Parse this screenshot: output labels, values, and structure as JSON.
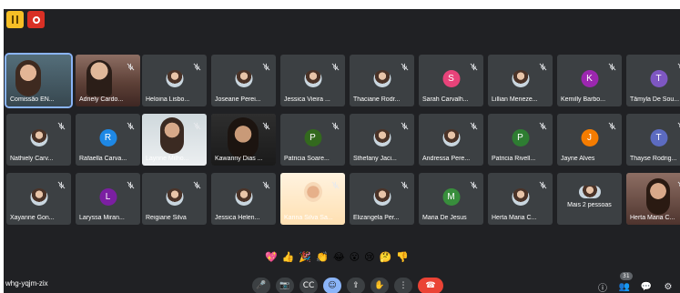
{
  "meeting_code": "whg-yqjm-zix",
  "participant_count": "31",
  "participants": [
    {
      "name": "Comissão EN...",
      "kind": "video",
      "video": "v7",
      "active": true
    },
    {
      "name": "Adriely Cardo...",
      "kind": "video",
      "video": "v1"
    },
    {
      "name": "Heloina Lisbo...",
      "kind": "photo"
    },
    {
      "name": "Joseane Perei...",
      "kind": "photo"
    },
    {
      "name": "Jessica Vieira ...",
      "kind": "photo"
    },
    {
      "name": "Thaciane Rodr...",
      "kind": "photo"
    },
    {
      "name": "Sarah Carvalh...",
      "kind": "letter",
      "letter": "S",
      "color": "#e8437a"
    },
    {
      "name": "Lillian Meneze...",
      "kind": "photo"
    },
    {
      "name": "Kemilly Barbo...",
      "kind": "letter",
      "letter": "K",
      "color": "#9c27b0"
    },
    {
      "name": "Tâmyla De Sou...",
      "kind": "letter",
      "letter": "T",
      "color": "#7e57c2"
    },
    {
      "name": "Nathiely Carv...",
      "kind": "photo"
    },
    {
      "name": "Rafaella Carva...",
      "kind": "letter",
      "letter": "R",
      "color": "#1e88e5"
    },
    {
      "name": "Laynne Milho...",
      "kind": "video",
      "video": "v2"
    },
    {
      "name": "Kawanny Dias ...",
      "kind": "video",
      "video": "v4"
    },
    {
      "name": "Patricia Soare...",
      "kind": "letter",
      "letter": "P",
      "color": "#33691e"
    },
    {
      "name": "Sthefany Jaci...",
      "kind": "photo"
    },
    {
      "name": "Andressa Pere...",
      "kind": "photo"
    },
    {
      "name": "Patricia Rivell...",
      "kind": "letter",
      "letter": "P",
      "color": "#2e7d32"
    },
    {
      "name": "Jayne Alves",
      "kind": "letter",
      "letter": "J",
      "color": "#f57c00"
    },
    {
      "name": "Thayse Rodrig...",
      "kind": "letter",
      "letter": "T",
      "color": "#5c6bc0"
    },
    {
      "name": "Xayanne Gon...",
      "kind": "photo"
    },
    {
      "name": "Laryssa Miran...",
      "kind": "letter",
      "letter": "L",
      "color": "#7b1fa2"
    },
    {
      "name": "Reigiane Silva",
      "kind": "photo"
    },
    {
      "name": "Jessica Helen...",
      "kind": "photo"
    },
    {
      "name": "Karina Silva Sa...",
      "kind": "video",
      "video": "v5"
    },
    {
      "name": "Elizangela Per...",
      "kind": "photo"
    },
    {
      "name": "Maria De Jesus",
      "kind": "letter",
      "letter": "M",
      "color": "#388e3c"
    },
    {
      "name": "Herta Maria C...",
      "kind": "photo"
    },
    {
      "name": "Mais 2 pessoas",
      "kind": "more"
    },
    {
      "name": "Herta Maria C...",
      "kind": "video",
      "video": "v6"
    }
  ],
  "reactions": [
    "💖",
    "👍",
    "🎉",
    "👏",
    "😂",
    "😮",
    "😢",
    "🤔",
    "👎"
  ],
  "controls": {
    "mic": "🎤",
    "camera": "📷",
    "captions": "CC",
    "emoji": "☺",
    "present": "⇪",
    "hand": "✋",
    "more": "⋮",
    "end": "☎"
  },
  "right": {
    "info": "ⓘ",
    "people": "👥",
    "chat": "💬",
    "activities": "⚙"
  }
}
